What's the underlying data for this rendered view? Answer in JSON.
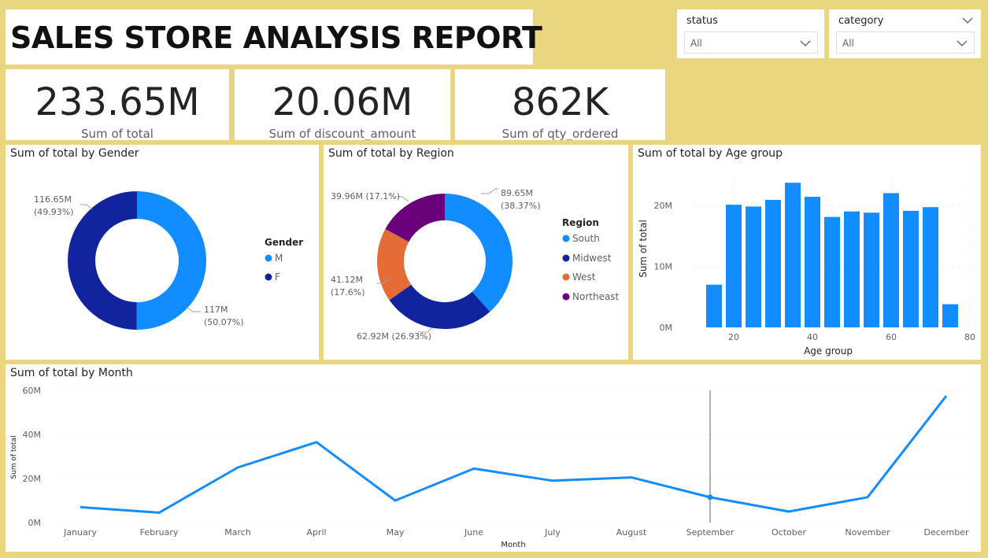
{
  "report_title": "SALES STORE ANALYSIS REPORT",
  "slicers": [
    {
      "label": "status",
      "value": "All"
    },
    {
      "label": "category",
      "value": "All"
    }
  ],
  "kpis": [
    {
      "value": "233.65M",
      "label": "Sum of total"
    },
    {
      "value": "20.06M",
      "label": "Sum of discount_amount"
    },
    {
      "value": "862K",
      "label": "Sum of qty_ordered"
    }
  ],
  "colors": {
    "background": "#ead67f",
    "light_blue": "#118dff",
    "dark_blue": "#12239e",
    "orange": "#e66c37",
    "purple": "#6b007b"
  },
  "chart_data": [
    {
      "type": "pie",
      "variant": "donut",
      "title": "Sum of total by Gender",
      "legend_title": "Gender",
      "legend_position": "right",
      "slices": [
        {
          "name": "M",
          "value": 117.0,
          "label": "117M",
          "pct": "(50.07%)",
          "color": "#118dff"
        },
        {
          "name": "F",
          "value": 116.65,
          "label": "116.65M",
          "pct": "(49.93%)",
          "color": "#12239e"
        }
      ]
    },
    {
      "type": "pie",
      "variant": "donut",
      "title": "Sum of total by Region",
      "legend_title": "Region",
      "legend_position": "right",
      "slices": [
        {
          "name": "South",
          "value": 89.65,
          "label": "89.65M",
          "pct": "(38.37%)",
          "color": "#118dff"
        },
        {
          "name": "Midwest",
          "value": 62.92,
          "label": "62.92M",
          "pct": "(26.93%)",
          "color": "#12239e"
        },
        {
          "name": "West",
          "value": 41.12,
          "label": "41.12M",
          "pct": "(17.6%)",
          "color": "#e66c37"
        },
        {
          "name": "Northeast",
          "value": 39.96,
          "label": "39.96M",
          "pct": "(17.1%)",
          "color": "#6b007b"
        }
      ]
    },
    {
      "type": "bar",
      "title": "Sum of total by Age group",
      "xlabel": "Age group",
      "ylabel": "Sum of total",
      "x": [
        15,
        20,
        25,
        30,
        35,
        40,
        45,
        50,
        55,
        60,
        65,
        70,
        75
      ],
      "values": [
        7.0,
        20.1,
        19.8,
        20.9,
        23.7,
        21.4,
        18.1,
        19.0,
        18.8,
        22.0,
        19.1,
        19.7,
        3.8
      ],
      "xlim": [
        10,
        80
      ],
      "xticks": [
        "20",
        "40",
        "60",
        "80"
      ],
      "ylim": [
        0,
        24.5
      ],
      "yticks": [
        "0M",
        "10M",
        "20M"
      ],
      "color": "#118dff",
      "grid": true
    },
    {
      "type": "line",
      "title": "Sum of total by Month",
      "xlabel": "Month",
      "ylabel": "Sum of total",
      "categories": [
        "January",
        "February",
        "March",
        "April",
        "May",
        "June",
        "July",
        "August",
        "September",
        "October",
        "November",
        "December"
      ],
      "values": [
        7.0,
        4.5,
        25.0,
        36.5,
        10.0,
        24.5,
        19.0,
        20.5,
        11.5,
        5.0,
        11.5,
        57.5
      ],
      "ylim": [
        0,
        60
      ],
      "yticks": [
        "0M",
        "20M",
        "40M",
        "60M"
      ],
      "highlight": "September",
      "color": "#118dff",
      "grid": true
    }
  ]
}
